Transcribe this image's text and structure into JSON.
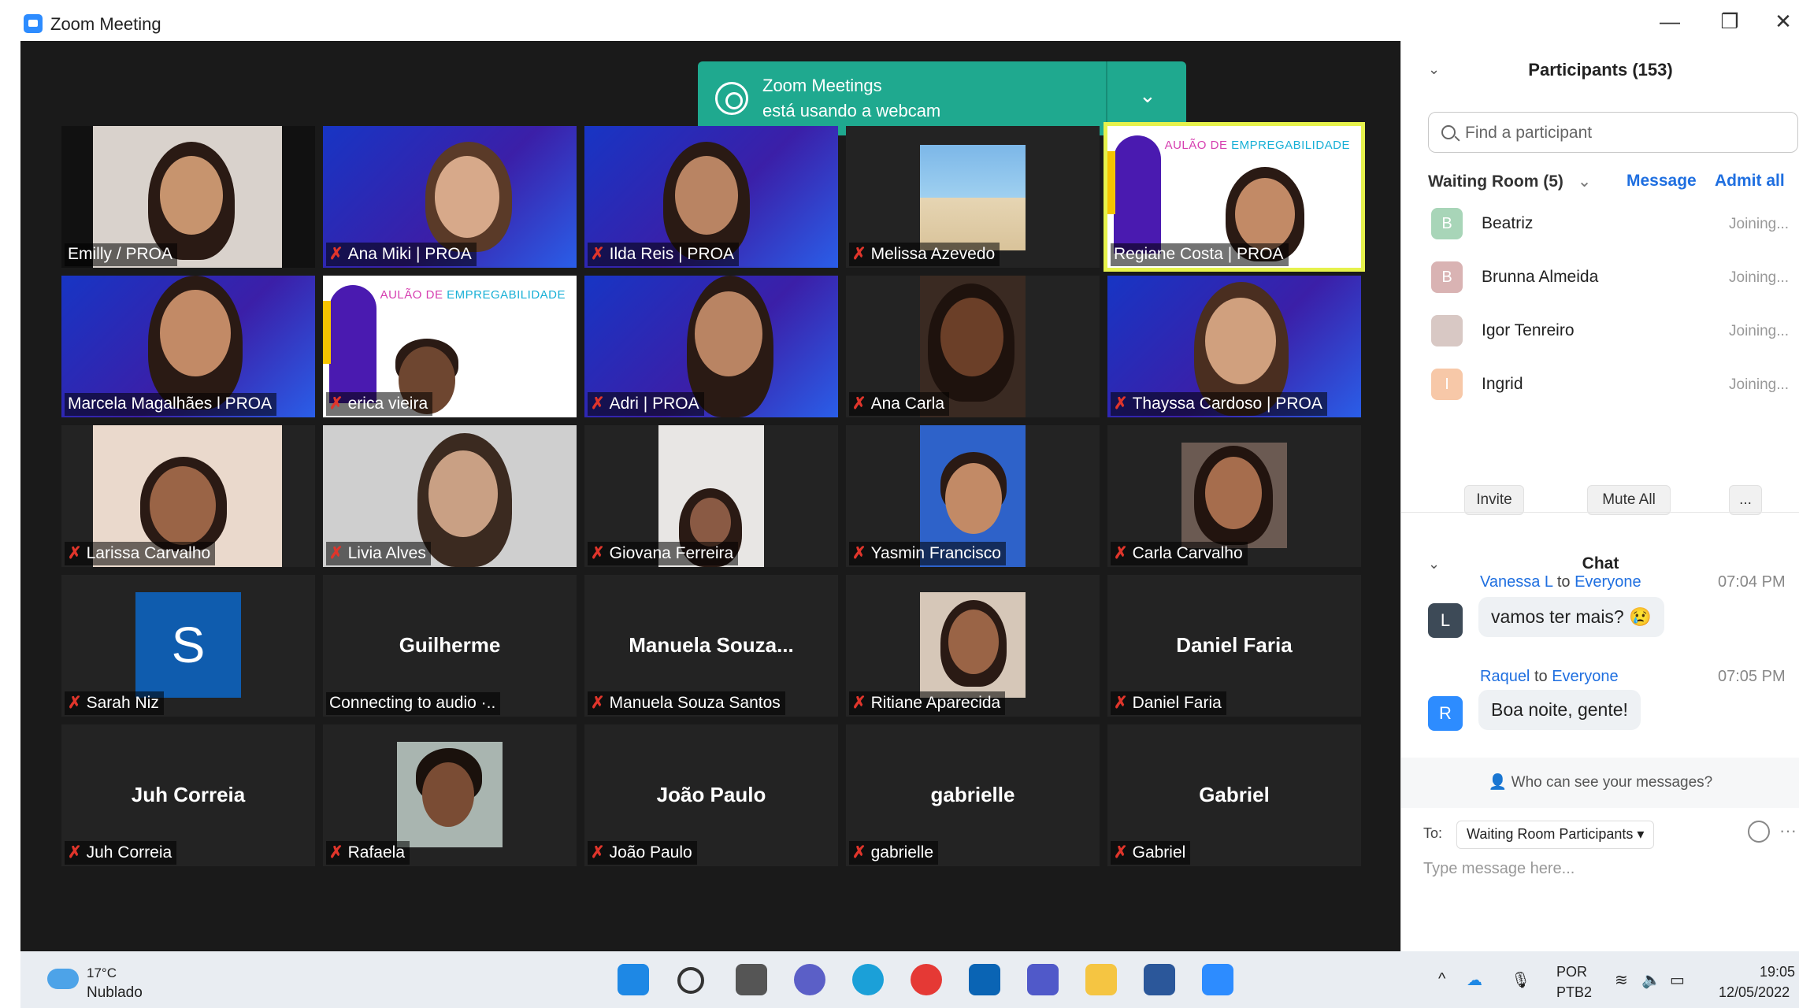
{
  "window": {
    "title": "Zoom Meeting",
    "controls": [
      "—",
      "❐",
      "✕"
    ]
  },
  "notification": {
    "line1": "Zoom Meetings",
    "line2": "está usando a webcam",
    "icon": "webcam-icon"
  },
  "tiles": [
    {
      "label": "Emilly / PROA",
      "muted": false
    },
    {
      "label": "Ana Miki | PROA",
      "muted": true
    },
    {
      "label": "Ilda Reis | PROA",
      "muted": true
    },
    {
      "label": "Melissa Azevedo",
      "muted": true
    },
    {
      "label": "Regiane Costa | PROA",
      "muted": false
    },
    {
      "label": "Marcela Magalhães l PROA",
      "muted": false
    },
    {
      "label": "erica vieira",
      "muted": true
    },
    {
      "label": "Adri | PROA",
      "muted": true
    },
    {
      "label": "Ana Carla",
      "muted": true
    },
    {
      "label": "Thayssa Cardoso | PROA",
      "muted": true
    },
    {
      "label": "Larissa Carvalho",
      "muted": true
    },
    {
      "label": "Livia Alves",
      "muted": true
    },
    {
      "label": "Giovana Ferreira",
      "muted": true
    },
    {
      "label": "Yasmin Francisco",
      "muted": true
    },
    {
      "label": "Carla Carvalho",
      "muted": true
    },
    {
      "label": "Sarah Niz",
      "muted": true
    },
    {
      "label": "Connecting to audio ·..",
      "bigname": "Guilherme",
      "muted": false
    },
    {
      "label": "Manuela Souza Santos",
      "bigname": "Manuela  Souza...",
      "muted": true
    },
    {
      "label": "Ritiane Aparecida",
      "muted": true
    },
    {
      "label": "Daniel Faria",
      "bigname": "Daniel Faria",
      "muted": true
    },
    {
      "label": "Juh Correia",
      "bigname": "Juh Correia",
      "muted": true
    },
    {
      "label": "Rafaela",
      "muted": true
    },
    {
      "label": "João Paulo",
      "bigname": "João Paulo",
      "muted": true
    },
    {
      "label": "gabrielle",
      "bigname": "gabrielle",
      "muted": true
    },
    {
      "label": "Gabriel",
      "bigname": "Gabriel",
      "muted": true
    }
  ],
  "slides": {
    "banner_pre": "AULÃO DE ",
    "banner_accent": "EMPREGABILIDADE",
    "sarah_initial": "S"
  },
  "participants": {
    "title": "Participants (153)",
    "search_placeholder": "Find a participant",
    "waiting_room": "Waiting Room (5)",
    "message": "Message",
    "admit_all": "Admit all",
    "waiting": [
      {
        "initial": "B",
        "name": "Beatriz",
        "status": "Joining...",
        "color": "#a8d5b8"
      },
      {
        "initial": "B",
        "name": "Brunna Almeida",
        "status": "Joining...",
        "color": "#d9b3b3"
      },
      {
        "initial": "",
        "name": "Igor Tenreiro",
        "status": "Joining...",
        "color": "#d8c8c4"
      },
      {
        "initial": "I",
        "name": "Ingrid",
        "status": "Joining...",
        "color": "#f7c8a8"
      }
    ],
    "invite": "Invite",
    "mute_all": "Mute All",
    "more": "..."
  },
  "chat": {
    "title": "Chat",
    "messages": [
      {
        "sender": "Vanessa L",
        "to": " to ",
        "target": "Everyone",
        "time": "07:04 PM",
        "initial": "L",
        "text": "vamos ter mais? 😢",
        "color": "#3d4a57"
      },
      {
        "sender": "Raquel",
        "to": " to ",
        "target": "Everyone",
        "time": "07:05 PM",
        "initial": "R",
        "text": "Boa noite, gente!",
        "color": "#2d8cff"
      }
    ],
    "who_can_see": "Who can see your messages?",
    "to_label": "To:",
    "to_value": "Waiting Room Participants ▾",
    "placeholder": "Type message here..."
  },
  "taskbar": {
    "temp": "17°C",
    "weather": "Nublado",
    "lang1": "POR",
    "lang2": "PTB2",
    "time": "19:05",
    "date": "12/05/2022"
  }
}
